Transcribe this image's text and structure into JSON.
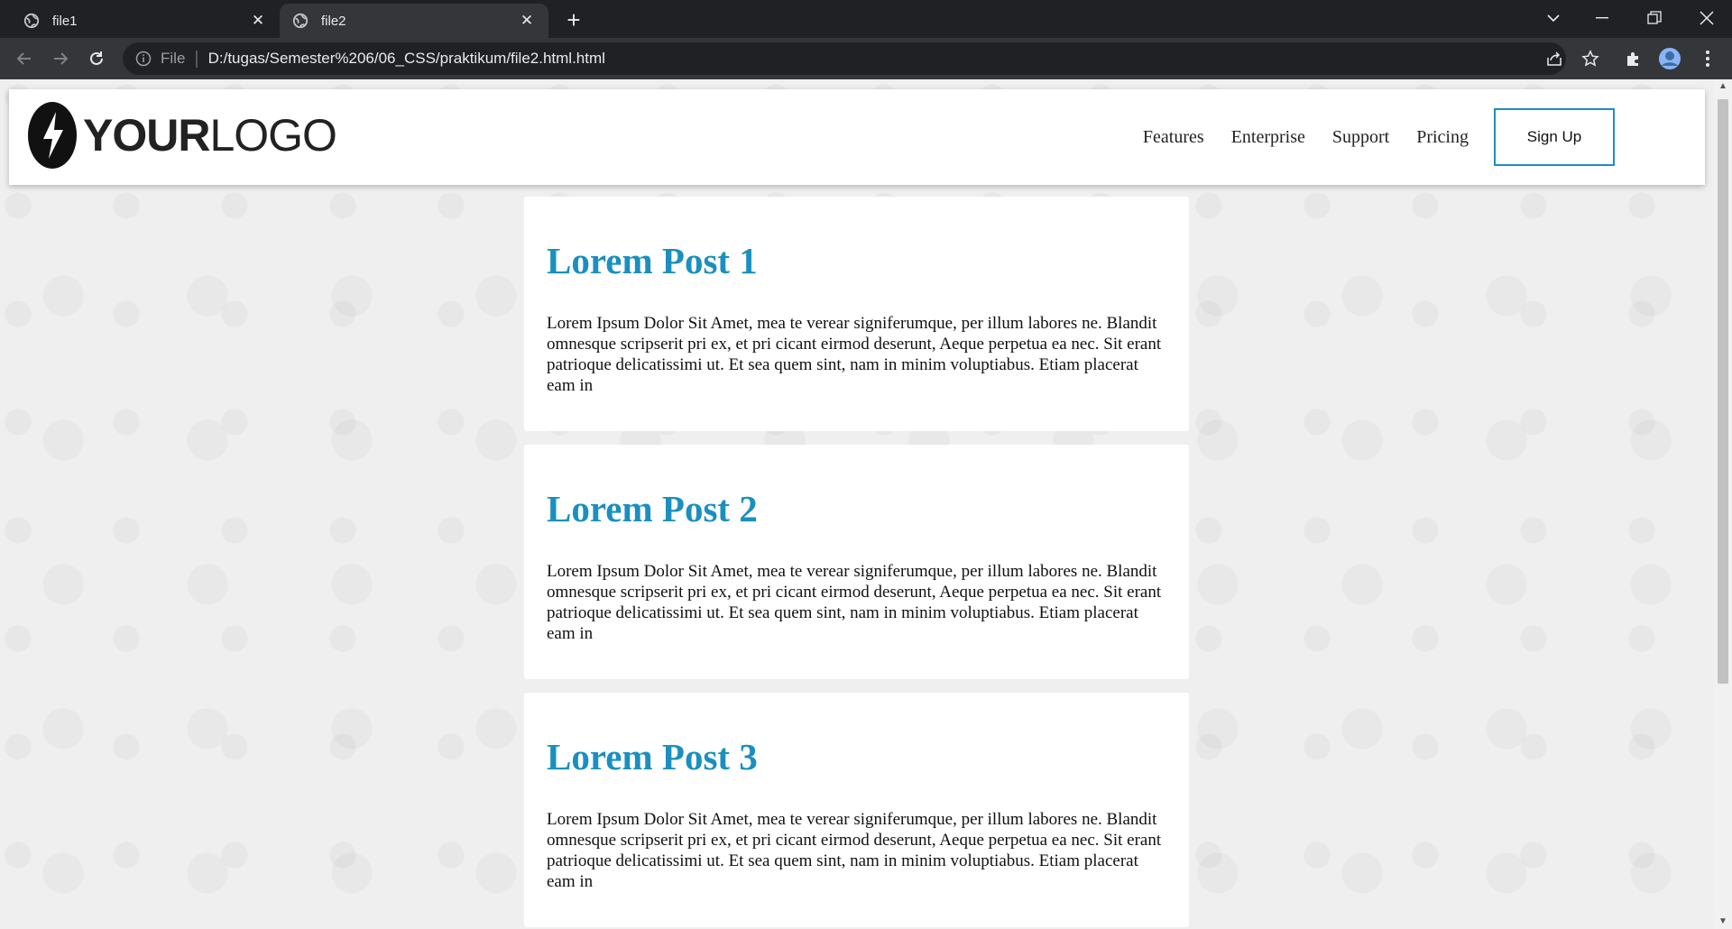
{
  "browser": {
    "tabs": [
      {
        "title": "file1",
        "active": false
      },
      {
        "title": "file2",
        "active": true
      }
    ],
    "address": {
      "scheme_label": "File",
      "url": "D:/tugas/Semester%206/06_CSS/praktikum/file2.html.html"
    }
  },
  "site": {
    "logo": {
      "bold": "YOUR",
      "light": "LOGO"
    },
    "nav": [
      "Features",
      "Enterprise",
      "Support",
      "Pricing"
    ],
    "signup_label": "Sign Up",
    "accent_color": "#1b8fbf"
  },
  "posts": [
    {
      "title": "Lorem Post 1",
      "body": "Lorem Ipsum Dolor Sit Amet, mea te verear signiferumque, per illum labores ne. Blandit omnesque scripserit pri ex, et pri cicant eirmod deserunt, Aeque perpetua ea nec. Sit erant patrioque delicatissimi ut. Et sea quem sint, nam in minim voluptiabus. Etiam placerat eam in"
    },
    {
      "title": "Lorem Post 2",
      "body": "Lorem Ipsum Dolor Sit Amet, mea te verear signiferumque, per illum labores ne. Blandit omnesque scripserit pri ex, et pri cicant eirmod deserunt, Aeque perpetua ea nec. Sit erant patrioque delicatissimi ut. Et sea quem sint, nam in minim voluptiabus. Etiam placerat eam in"
    },
    {
      "title": "Lorem Post 3",
      "body": "Lorem Ipsum Dolor Sit Amet, mea te verear signiferumque, per illum labores ne. Blandit omnesque scripserit pri ex, et pri cicant eirmod deserunt, Aeque perpetua ea nec. Sit erant patrioque delicatissimi ut. Et sea quem sint, nam in minim voluptiabus. Etiam placerat eam in"
    }
  ]
}
